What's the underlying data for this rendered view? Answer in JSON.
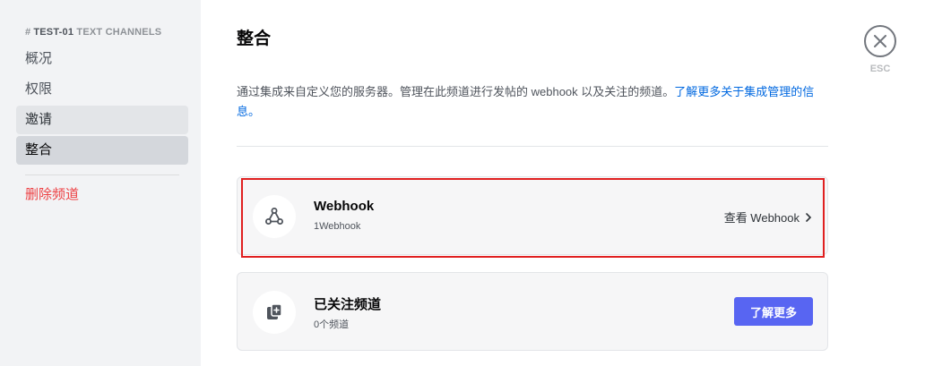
{
  "sidebar": {
    "channel_hash": "#",
    "channel_name": "TEST-01",
    "channel_header_suffix": "TEXT CHANNELS",
    "items": [
      {
        "label": "概况"
      },
      {
        "label": "权限"
      },
      {
        "label": "邀请"
      },
      {
        "label": "整合"
      }
    ],
    "danger_item": "删除频道"
  },
  "main": {
    "title": "整合",
    "description": "通过集成来自定义您的服务器。管理在此频道进行发帖的 webhook 以及关注的频道。",
    "learn_more_link": "了解更多关于集成管理的信息。",
    "close_label": "ESC",
    "cards": {
      "webhook": {
        "title": "Webhook",
        "subtitle": "1Webhook",
        "action_label": "查看 Webhook",
        "icon": "webhook-icon"
      },
      "followed": {
        "title": "已关注频道",
        "subtitle": "0个频道",
        "button_label": "了解更多",
        "icon": "followed-channel-icon"
      }
    }
  },
  "colors": {
    "accent": "#5865f2",
    "danger": "#ed4245",
    "link": "#0068e0",
    "highlight": "#e02020"
  }
}
